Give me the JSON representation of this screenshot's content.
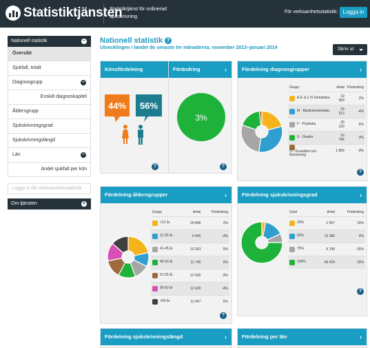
{
  "header": {
    "logo_text": "Statistiktjänsten",
    "subtitle": "Statistiktjänst för ordinerad sjukskrivning",
    "right_label": "För verksamhetsstatistik:",
    "login_label": "Logga in"
  },
  "sidebar": {
    "head": "Nationell statistik",
    "items": [
      {
        "label": "Översikt"
      },
      {
        "label": "Sjukfall, totalt"
      },
      {
        "label": "Diagnosgrupp"
      },
      {
        "label": "Enskilt diagnoskapitel"
      },
      {
        "label": "Åldersgrupp"
      },
      {
        "label": "Sjukskrivningsgrad"
      },
      {
        "label": "Sjukskrivningslängd"
      },
      {
        "label": "Län"
      },
      {
        "label": "Andel sjukfall per kön"
      }
    ],
    "login_placeholder": "Logga in för verksamhetsstatistik",
    "about": "Om tjänsten",
    "minus": "−",
    "plus": "+"
  },
  "main": {
    "title": "Nationell statistik",
    "help": "?",
    "subtitle": "Utvecklingen i landet de senaste tre månaderna, november 2013–januari 2014",
    "print": "Skriv ut"
  },
  "panels": {
    "kon": {
      "title": "Könsfördelning",
      "female": "44%",
      "male": "56%"
    },
    "forandring": {
      "title": "Förändring",
      "value": "3%"
    },
    "diagnos": {
      "title": "Fördelning diagnosgrupper",
      "headers": [
        "Grupp",
        "Antal",
        "Förändring"
      ],
      "rows": [
        {
          "name": "A-E G-L N Somatiska",
          "antal": "19 583",
          "change": "2%",
          "color": "#f5b41c"
        },
        {
          "name": "M - Muskuloskeletala",
          "antal": "29 513",
          "change": "-4%",
          "color": "#2f9fd0"
        },
        {
          "name": "F - Psykiska",
          "antal": "26 120",
          "change": "5%",
          "color": "#a6a6a6"
        },
        {
          "name": "S - Skador",
          "antal": "16 784",
          "change": "3%",
          "color": "#1fb23a"
        },
        {
          "name": "O - Graviditet och förlossning",
          "antal": "1 869",
          "change": "-3%",
          "color": "#9e6a3e"
        }
      ]
    },
    "alder": {
      "title": "Fördelning åldersgrupper",
      "headers": [
        "Grupp",
        "Antal",
        "Förändring"
      ],
      "rows": [
        {
          "name": "<21 år",
          "antal": "18 848",
          "change": "2%",
          "color": "#f5b41c"
        },
        {
          "name": "21-25 år",
          "antal": "9 495",
          "change": "-4%",
          "color": "#2f9fd0"
        },
        {
          "name": "41-45 år",
          "antal": "10 363",
          "change": "5%",
          "color": "#a6a6a6"
        },
        {
          "name": "46-50 år",
          "antal": "11 745",
          "change": "0%",
          "color": "#1fb23a"
        },
        {
          "name": "51-55 år",
          "antal": "12 435",
          "change": "-3%",
          "color": "#9e6a3e"
        },
        {
          "name": "56-60 år",
          "antal": "12 439",
          "change": "-4%",
          "color": "#d94fb8"
        },
        {
          "name": ">60 år",
          "antal": "11 947",
          "change": "5%",
          "color": "#404040"
        }
      ]
    },
    "grad": {
      "title": "Fördelning sjukskrivningsgrad",
      "headers": [
        "Grad",
        "Antal",
        "Förändring"
      ],
      "rows": [
        {
          "name": "25%",
          "antal": "2 657",
          "change": "15%",
          "color": "#f5b41c"
        },
        {
          "name": "50%",
          "antal": "13 286",
          "change": "0%",
          "color": "#2f9fd0"
        },
        {
          "name": "75%",
          "antal": "6 198",
          "change": "-15%",
          "color": "#a6a6a6"
        },
        {
          "name": "100%",
          "antal": "66 429",
          "change": "15%",
          "color": "#1fb23a"
        }
      ]
    },
    "langd": {
      "title": "Fördelning sjukskrivningslängd"
    },
    "lan": {
      "title": "Fördelning per län"
    }
  },
  "icons": {
    "chevron": "›",
    "help": "?"
  }
}
